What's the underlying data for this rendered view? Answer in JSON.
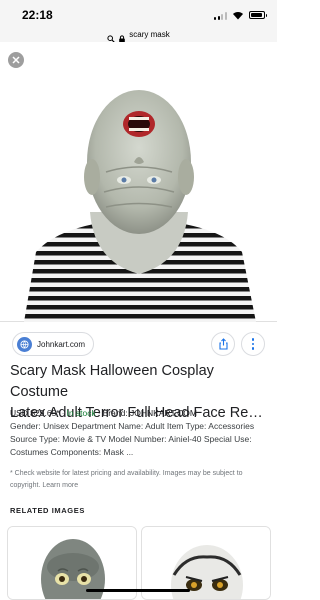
{
  "status_bar": {
    "time": "22:18"
  },
  "url_bar": {
    "query": "scary mask"
  },
  "icons": {
    "close": "close-icon",
    "share": "share-icon",
    "more": "more-vert-icon",
    "search": "search-icon",
    "lock": "lock-icon",
    "favicon": "globe-icon"
  },
  "result": {
    "site": "Johnkart.com",
    "title_line1": "Scary Mask Halloween Cosplay Costume",
    "title_line2": "Latex Adult Terror Full Head Face Rever...",
    "price": "USD $29.65*",
    "stock": "In stock",
    "brand": "Brand: JOHNKART.COM",
    "description": "Gender: Unisex Department Name: Adult Item Type: Accessories Source Type: Movie & TV Model Number: Ainiel-40 Special Use: Costumes Components: Mask ...",
    "disclaimer": "* Check website for latest pricing and availability. Images may be subject to copyright.",
    "learn_more": "Learn more"
  },
  "related": {
    "heading": "RELATED IMAGES"
  },
  "colors": {
    "accent_blue": "#1a73e8",
    "in_stock_green": "#188038",
    "muted_text": "#70757a"
  }
}
